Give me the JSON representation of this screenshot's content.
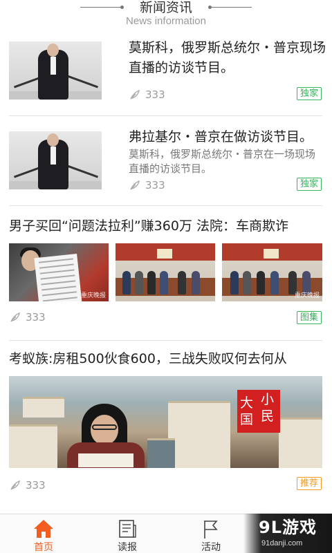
{
  "header": {
    "title": "新闻资讯",
    "subtitle": "News information"
  },
  "articles": [
    {
      "headline": "莫斯科，俄罗斯总统尔・普京现场直播的访谈节目。",
      "count": "333",
      "tag": "独家",
      "tag_color": "#35b45b"
    },
    {
      "headline": "弗拉基尔・普京在做访谈节目。",
      "summary": "莫斯科，俄罗斯总统尔・普京在一场现场直播的访谈节目。",
      "count": "333",
      "tag": "独家",
      "tag_color": "#35b45b"
    },
    {
      "headline": "男子买回“问题法拉利”赚360万 法院：车商欺诈",
      "count": "333",
      "tag": "图集",
      "tag_color": "#35b45b",
      "watermark": "重庆晚报"
    },
    {
      "headline": "考蚁族:房租500伙食600，三战失败叹何去何从",
      "count": "333",
      "tag": "推荐",
      "tag_color": "#f39a1f",
      "logo_text": [
        "大",
        "小",
        "国",
        "民"
      ]
    }
  ],
  "tabbar": {
    "items": [
      {
        "label": "首页",
        "icon": "home-icon",
        "active": true
      },
      {
        "label": "读报",
        "icon": "newspaper-icon",
        "active": false
      },
      {
        "label": "活动",
        "icon": "flag-icon",
        "active": false
      }
    ],
    "active_color": "#f25c1f"
  },
  "brand": {
    "name": "9L游戏",
    "url": "91danji.com"
  }
}
